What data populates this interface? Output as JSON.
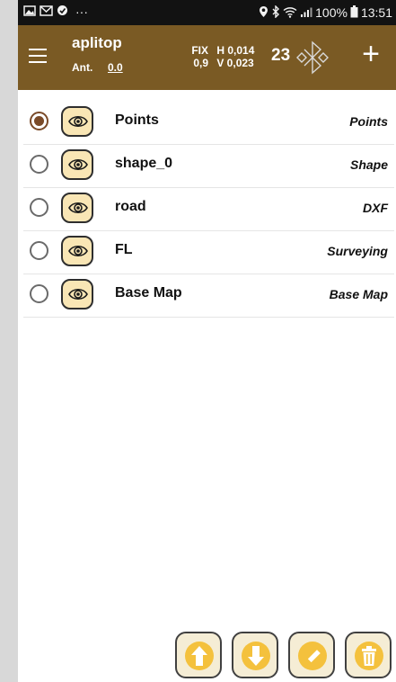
{
  "status_bar": {
    "notification_icons": [
      "image-icon",
      "gmail-icon",
      "sync-icon"
    ],
    "overflow_label": "···",
    "battery": "100%",
    "time": "13:51"
  },
  "app_bar": {
    "title": "aplitop",
    "antenna_label": "Ant.",
    "antenna_value": "0.0",
    "fix_label": "FIX",
    "h_precision": "H 0,014",
    "pdop": "0,9",
    "v_precision": "V 0,023",
    "satellites": "23",
    "add_label": "+"
  },
  "layers": [
    {
      "name": "Points",
      "type": "Points",
      "selected": true
    },
    {
      "name": "shape_0",
      "type": "Shape",
      "selected": false
    },
    {
      "name": "road",
      "type": "DXF",
      "selected": false
    },
    {
      "name": "FL",
      "type": "Surveying",
      "selected": false
    },
    {
      "name": "Base Map",
      "type": "Base Map",
      "selected": false
    }
  ],
  "toolbar": {
    "buttons": [
      "move-up",
      "move-down",
      "edit",
      "delete"
    ]
  },
  "colors": {
    "app_bar": "#7a5a24",
    "status_bar": "#121212",
    "eye_button_fill": "#f9e6b5",
    "toolbar_fill": "#f5edd5",
    "toolbar_icon": "#f4c13d",
    "selected_radio": "#7a4a28"
  }
}
